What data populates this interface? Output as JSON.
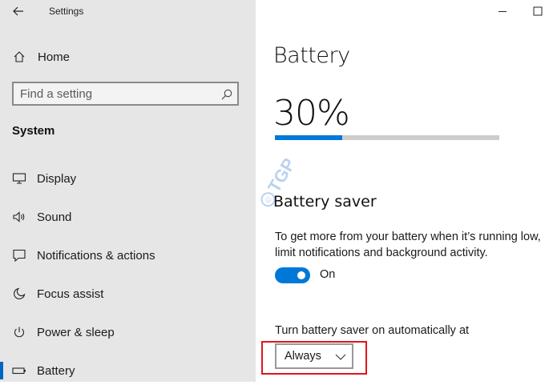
{
  "app": {
    "title": "Settings"
  },
  "sidebar": {
    "home_label": "Home",
    "search_placeholder": "Find a setting",
    "section_title": "System",
    "items": [
      {
        "label": "Display",
        "icon": "monitor-icon"
      },
      {
        "label": "Sound",
        "icon": "speaker-icon"
      },
      {
        "label": "Notifications & actions",
        "icon": "message-icon"
      },
      {
        "label": "Focus assist",
        "icon": "moon-icon"
      },
      {
        "label": "Power & sleep",
        "icon": "power-icon"
      },
      {
        "label": "Battery",
        "icon": "battery-icon",
        "selected": true
      }
    ]
  },
  "main": {
    "page_title": "Battery",
    "battery_percent_text": "30%",
    "battery_level_fraction": 0.3,
    "saver_title": "Battery saver",
    "saver_description_line1": "To get more from your battery when it’s running low,",
    "saver_description_line2": "limit notifications and background activity.",
    "saver_toggle_state": "On",
    "auto_label": "Turn battery saver on automatically at",
    "auto_value": "Always"
  },
  "watermark": {
    "text": "TGP"
  },
  "colors": {
    "accent": "#0078d7",
    "sidebar_bg": "#e6e6e6",
    "highlight_box": "#e0141e"
  }
}
